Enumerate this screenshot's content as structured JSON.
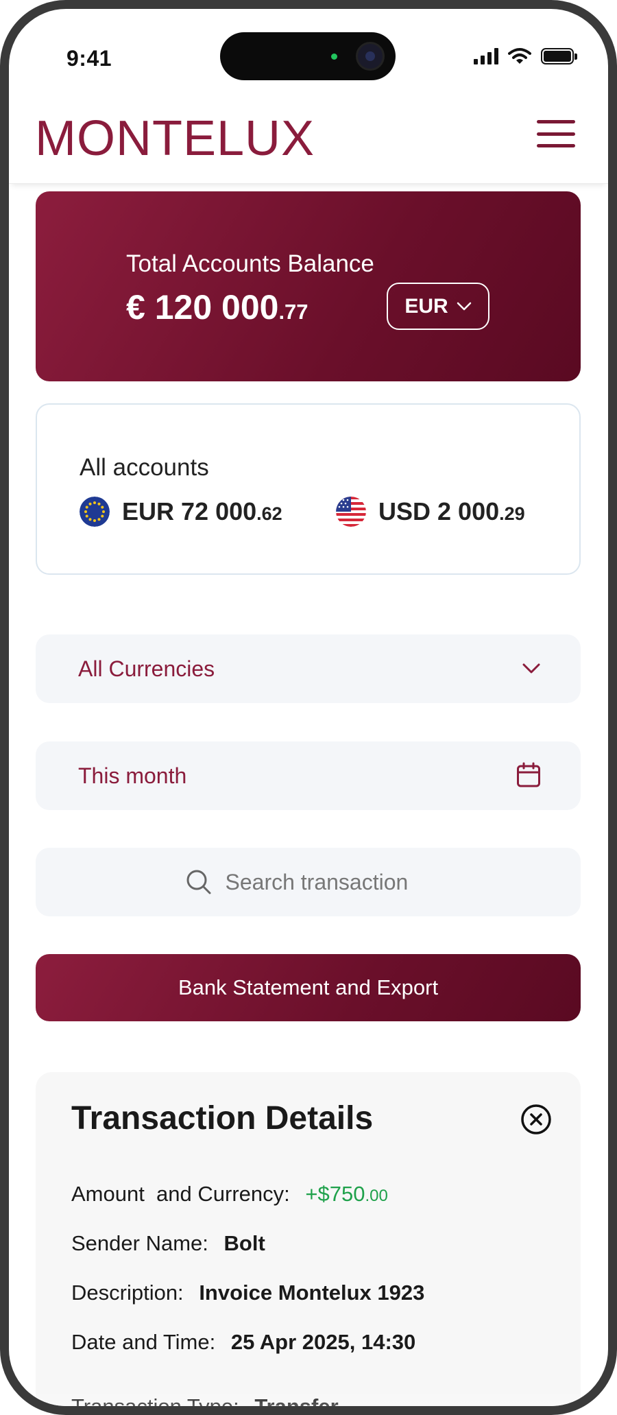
{
  "status_bar": {
    "time": "9:41"
  },
  "header": {
    "brand": "MONTELUX"
  },
  "balance_card": {
    "label": "Total Accounts Balance",
    "amount_main": "€ 120 000",
    "amount_cents": ".77",
    "currency": "EUR"
  },
  "accounts": {
    "title": "All accounts",
    "items": [
      {
        "code": "EUR",
        "amount_main": "72 000",
        "amount_cents": ".62",
        "flag": "eu-flag-icon"
      },
      {
        "code": "USD",
        "amount_main": "2 000",
        "amount_cents": ".29",
        "flag": "us-flag-icon"
      }
    ]
  },
  "filters": {
    "currency_label": "All Currencies",
    "period_label": "This month",
    "search_placeholder": "Search transaction"
  },
  "export_button": "Bank Statement and Export",
  "details": {
    "title": "Transaction Details",
    "rows": [
      {
        "key": "Amount  and Currency:",
        "value_main": "+$750",
        "value_cents": ".00"
      },
      {
        "key": "Sender Name:",
        "value": "Bolt"
      },
      {
        "key": "Description:",
        "value": "Invoice Montelux 1923"
      },
      {
        "key": "Date and Time:",
        "value": "25 Apr 2025, 14:30"
      },
      {
        "key": "Transaction Type:",
        "value": "Transfer"
      }
    ]
  },
  "colors": {
    "brand": "#8a1c3c",
    "brand_dark": "#5a0a22",
    "positive": "#1fa14b",
    "field_bg": "#f4f6f9"
  }
}
